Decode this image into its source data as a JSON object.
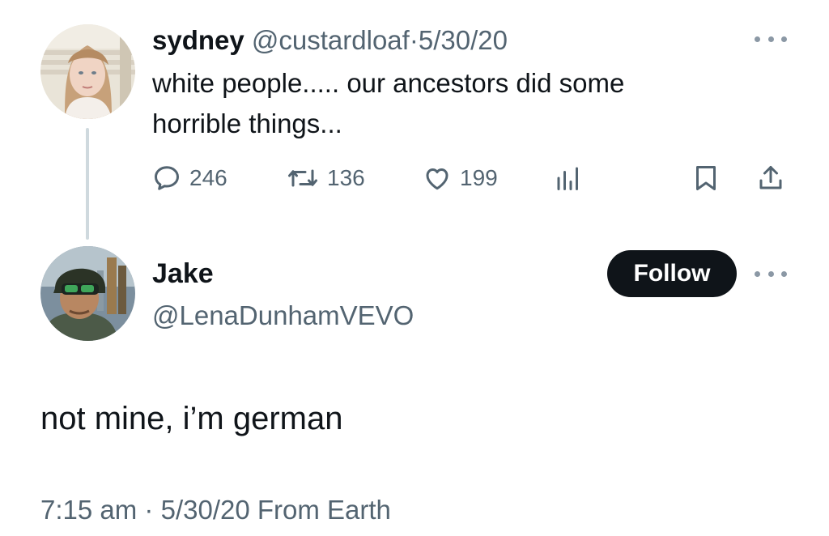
{
  "parent_tweet": {
    "display_name": "sydney",
    "handle": "@custardloaf",
    "separator": "·",
    "date": "5/30/20",
    "text_line1": "white people..... our ancestors did some",
    "text_line2": "horrible things...",
    "replies": "246",
    "retweets": "136",
    "likes": "199",
    "icons": [
      "reply-icon",
      "retweet-icon",
      "like-icon",
      "views-icon",
      "bookmark-icon",
      "share-icon",
      "more-icon"
    ]
  },
  "reply_tweet": {
    "display_name": "Jake",
    "handle": "@LenaDunhamVEVO",
    "follow_label": "Follow",
    "text": "not mine, i’m german",
    "time": "7:15 am",
    "separator": "·",
    "date": "5/30/20",
    "source": "From Earth"
  },
  "colors": {
    "text": "#0f1419",
    "muted": "#536471",
    "thread_line": "#cfd9de",
    "follow_bg": "#0f1419",
    "follow_text": "#ffffff"
  }
}
